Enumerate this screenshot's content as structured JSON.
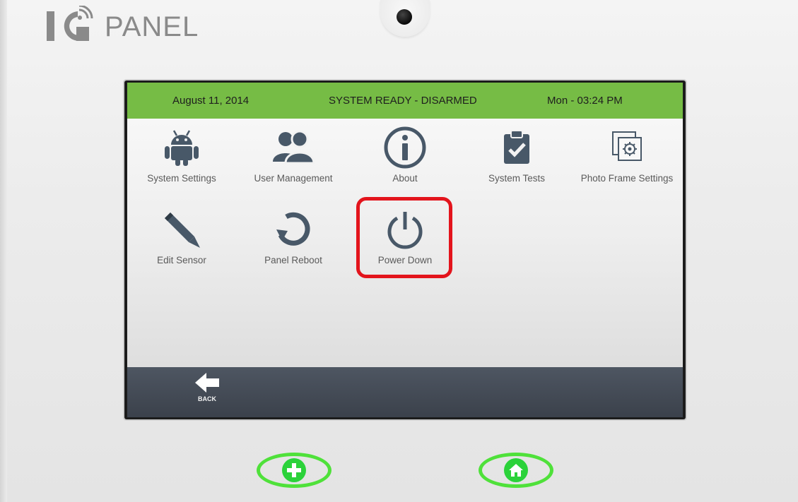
{
  "brand": {
    "name": "PANEL",
    "logo_letters": "IQ"
  },
  "status_bar": {
    "date": "August 11, 2014",
    "system_status": "SYSTEM READY - DISARMED",
    "time": "Mon - 03:24 PM",
    "color": "#76bc45"
  },
  "menu": {
    "items": [
      {
        "label": "System Settings",
        "icon": "android-icon"
      },
      {
        "label": "User Management",
        "icon": "users-icon"
      },
      {
        "label": "About",
        "icon": "info-icon"
      },
      {
        "label": "System Tests",
        "icon": "clipboard-check-icon"
      },
      {
        "label": "Photo Frame Settings",
        "icon": "photo-frame-gear-icon"
      },
      {
        "label": "Edit Sensor",
        "icon": "pencil-icon"
      },
      {
        "label": "Panel Reboot",
        "icon": "refresh-icon"
      },
      {
        "label": "Power Down",
        "icon": "power-icon"
      }
    ],
    "highlighted": "Power Down",
    "highlight_color": "#e3141c"
  },
  "nav": {
    "back_label": "BACK"
  },
  "hardware_buttons": [
    {
      "name": "emergency",
      "icon": "plus-icon"
    },
    {
      "name": "home",
      "icon": "home-icon"
    }
  ],
  "hardware_button_color": "#4fe13a"
}
